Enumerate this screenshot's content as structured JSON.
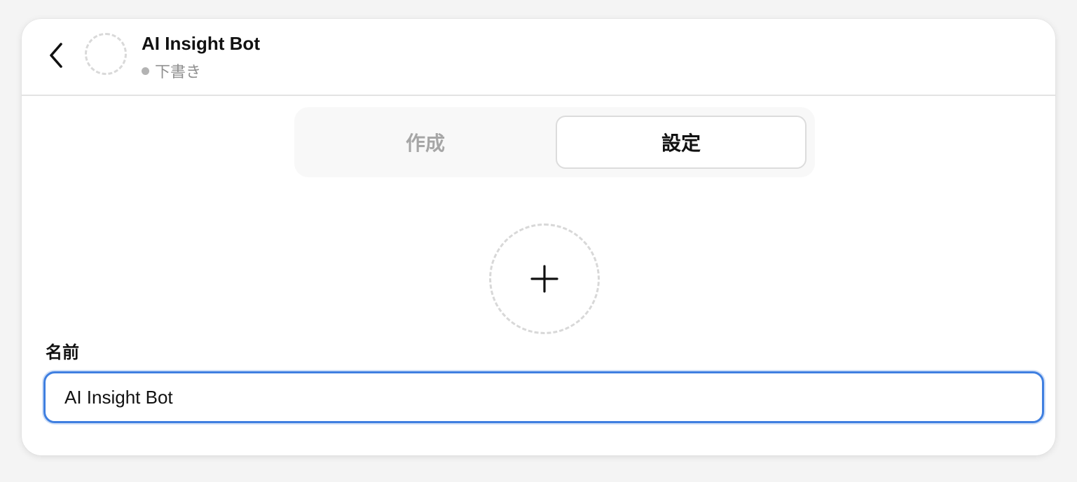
{
  "header": {
    "title": "AI Insight Bot",
    "status": "下書き",
    "back_icon": "chevron-left-icon",
    "avatar_icon": "empty-avatar-placeholder"
  },
  "tabs": [
    {
      "label": "作成",
      "active": false
    },
    {
      "label": "設定",
      "active": true
    }
  ],
  "upload": {
    "icon": "plus-icon"
  },
  "form": {
    "name_label": "名前",
    "name_value": "AI Insight Bot"
  },
  "colors": {
    "accent": "#3f7fe0",
    "muted_text": "#a6a6a6",
    "border": "#dcdcdc"
  }
}
